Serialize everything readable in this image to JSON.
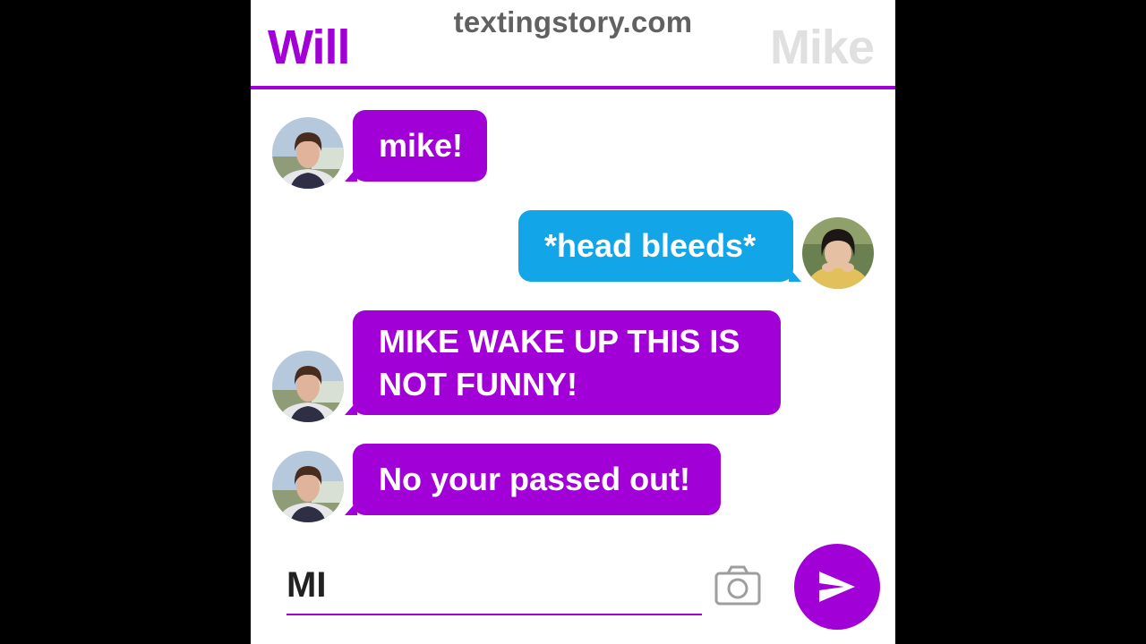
{
  "header": {
    "site": "textingstory.com",
    "left_contact": "Will",
    "right_contact": "Mike"
  },
  "colors": {
    "will_bubble": "#a100d6",
    "mike_bubble": "#12a5e8",
    "accent": "#a100d6",
    "inactive_name": "#e0e0e0"
  },
  "messages": [
    {
      "sender": "Will",
      "text": "mike!"
    },
    {
      "sender": "Mike",
      "text": "*head bleeds*"
    },
    {
      "sender": "Will",
      "line1": "MIKE WAKE UP THIS IS",
      "line2": "NOT FUNNY!"
    },
    {
      "sender": "Will",
      "text": "No your passed out!"
    }
  ],
  "composer": {
    "value": "MI",
    "camera_icon": "camera-icon",
    "send_icon": "send-icon"
  }
}
